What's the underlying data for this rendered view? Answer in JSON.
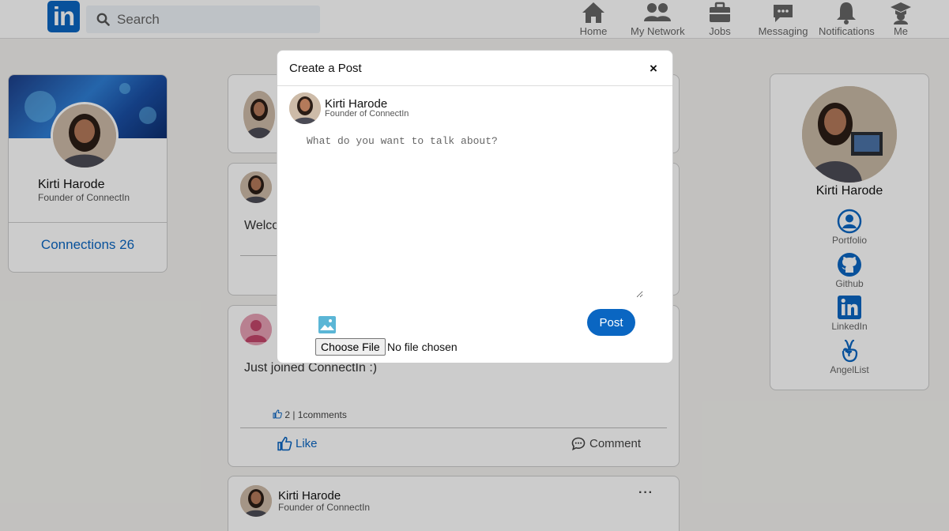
{
  "nav": {
    "logo_text": "in",
    "search_placeholder": "Search",
    "items": [
      {
        "label": "Home",
        "icon": "home-icon"
      },
      {
        "label": "My Network",
        "icon": "network-icon"
      },
      {
        "label": "Jobs",
        "icon": "briefcase-icon"
      },
      {
        "label": "Messaging",
        "icon": "messaging-icon"
      },
      {
        "label": "Notifications",
        "icon": "bell-icon"
      },
      {
        "label": "Me",
        "icon": "graduation-cap-icon"
      }
    ]
  },
  "profile": {
    "name": "Kirti Harode",
    "title": "Founder of ConnectIn",
    "connections": "Connections 26"
  },
  "feed": {
    "welcome_text": "Welco",
    "post3": {
      "text": "Just joined ConnectIn :)",
      "stats": "2 | 1comments",
      "like_label": "Like",
      "comment_label": "Comment"
    },
    "post4": {
      "name": "Kirti Harode",
      "title": "Founder of ConnectIn",
      "menu": "···"
    }
  },
  "sidebar_right": {
    "name": "Kirti Harode",
    "links": [
      {
        "label": "Portfolio",
        "icon": "user-circle-icon"
      },
      {
        "label": "Github",
        "icon": "github-icon"
      },
      {
        "label": "LinkedIn",
        "icon": "linkedin-icon"
      },
      {
        "label": "AngelList",
        "icon": "angellist-icon"
      }
    ]
  },
  "modal": {
    "title": "Create a Post",
    "close": "×",
    "author": "Kirti Harode",
    "author_title": "Founder of ConnectIn",
    "placeholder": "What do you want to talk about?",
    "post_button": "Post",
    "choose_file": "Choose File",
    "no_file": "No file chosen"
  },
  "colors": {
    "brand": "#0a66c2",
    "background": "#f3f2ef",
    "image_icon": "#5bb6d6"
  }
}
